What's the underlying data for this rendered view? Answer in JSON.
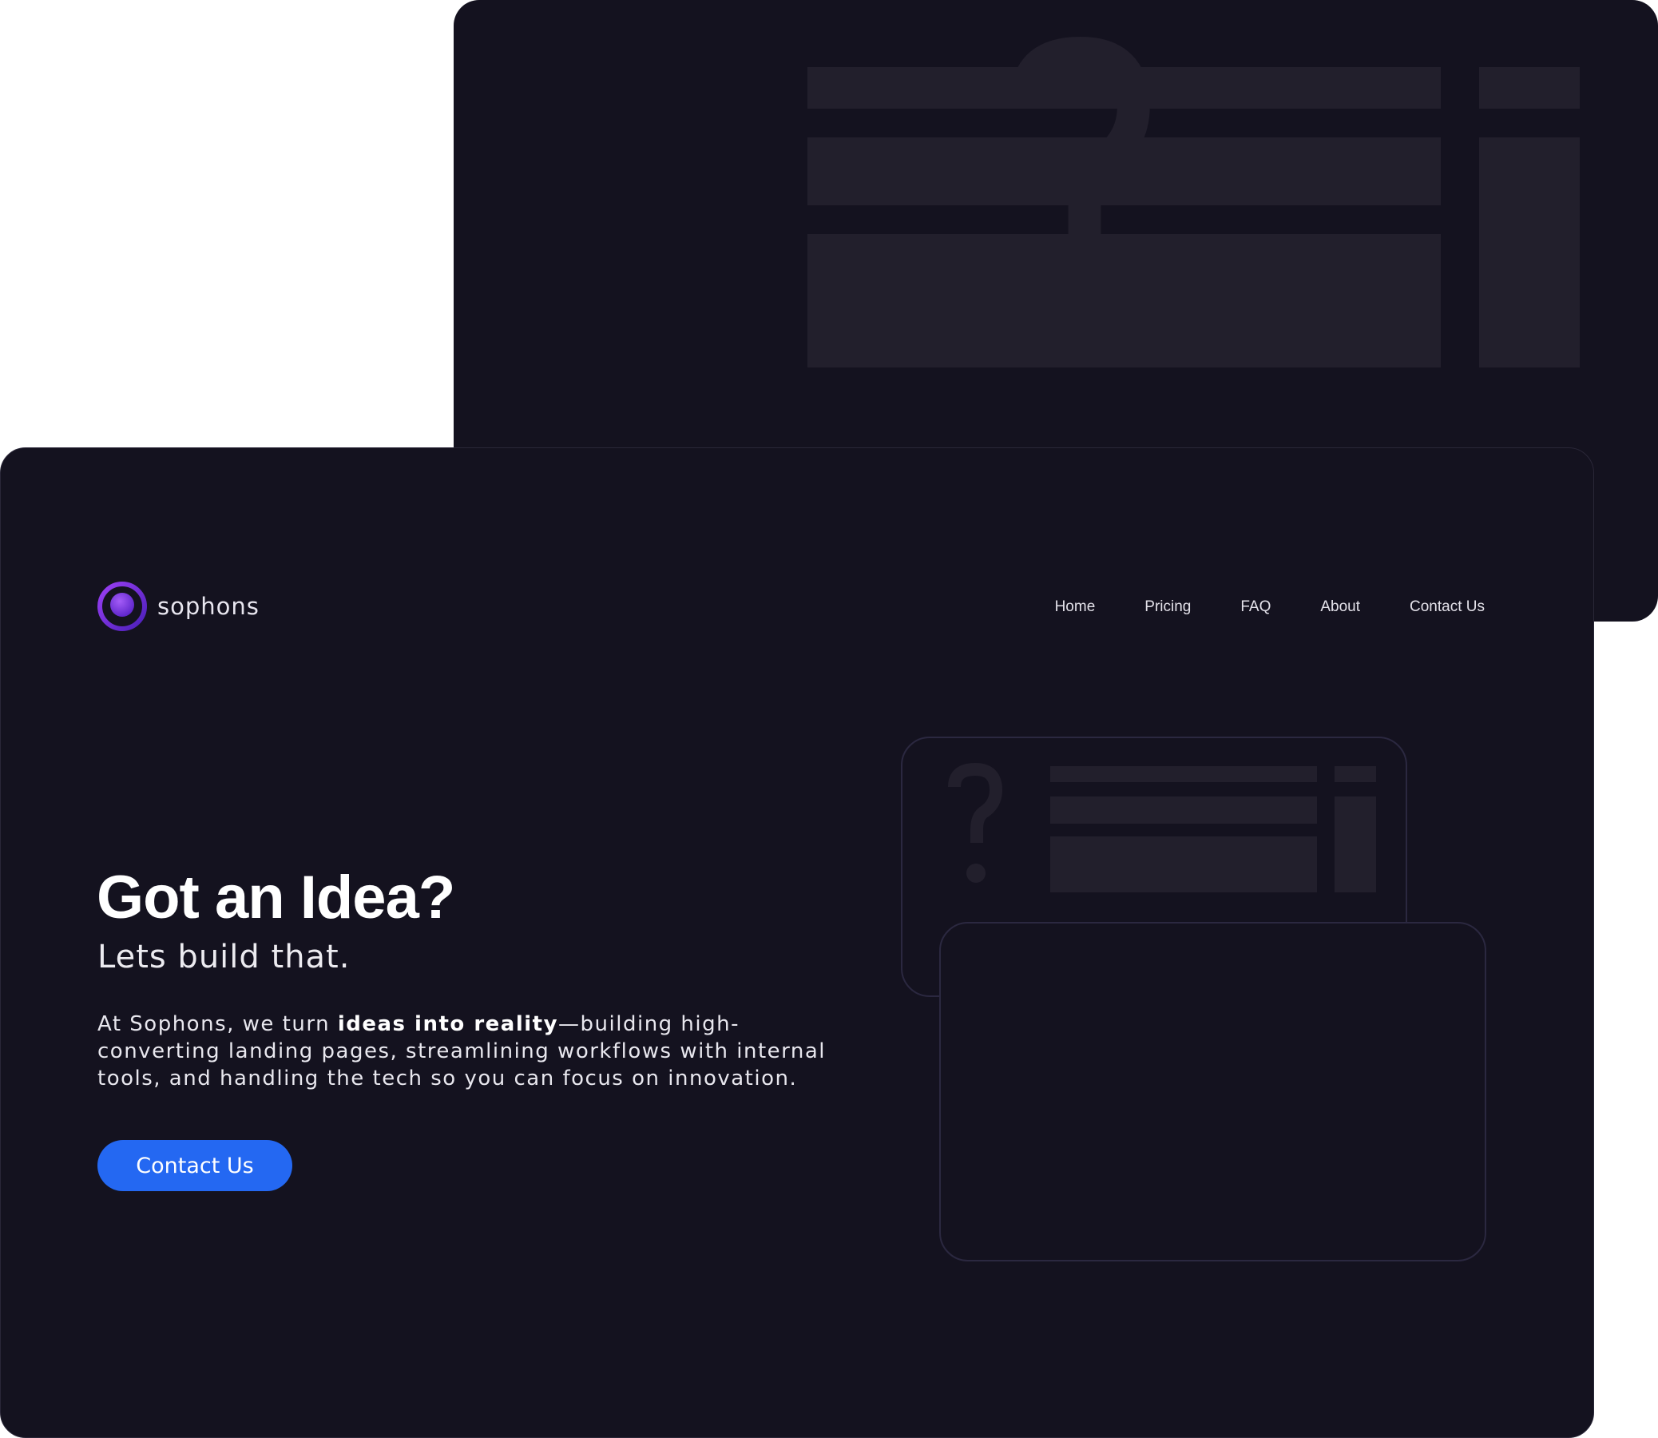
{
  "brand": {
    "name": "sophons",
    "logo_icon": "concentric-circle-logo",
    "accent_color": "#7b2ff2"
  },
  "nav": {
    "items": [
      {
        "label": "Home"
      },
      {
        "label": "Pricing"
      },
      {
        "label": "FAQ"
      },
      {
        "label": "About"
      },
      {
        "label": "Contact Us"
      }
    ]
  },
  "hero": {
    "title": "Got an Idea?",
    "subtitle": "Lets build that.",
    "body_prefix": "At Sophons, we turn ",
    "body_emphasis": "ideas into reality",
    "body_suffix": "—building high-converting landing pages, streamlining workflows with internal tools, and handling the tech so you can focus on innovation.",
    "cta_label": "Contact Us",
    "cta_color": "#2468f2"
  },
  "illustration": {
    "icon": "question-mark-icon"
  },
  "colors": {
    "background": "#14121f",
    "placeholder": "#221f2c",
    "outline": "#2b2840",
    "text": "#ffffff"
  }
}
